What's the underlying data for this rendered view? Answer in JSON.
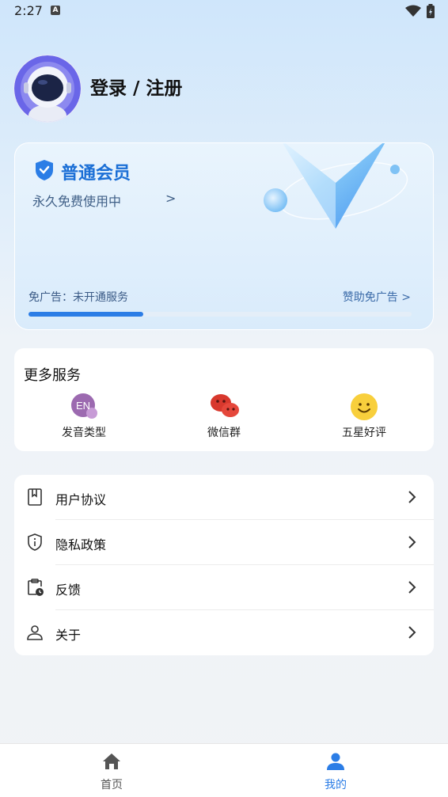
{
  "status_bar": {
    "time": "2:27",
    "a_icon": "A"
  },
  "profile": {
    "login_text": "登录 / 注册",
    "avatar": "astronaut-avatar"
  },
  "vip_card": {
    "title": "普通会员",
    "subtitle": "永久免费使用中",
    "chevron": ">",
    "ad_status": "免广告：未开通服务",
    "sponsor": "赞助免广告 >",
    "progress": 0.3
  },
  "services": {
    "title": "更多服务",
    "items": [
      {
        "label": "发音类型",
        "icon_text": "EN"
      },
      {
        "label": "微信群"
      },
      {
        "label": "五星好评"
      }
    ]
  },
  "menu": {
    "items": [
      {
        "label": "用户协议"
      },
      {
        "label": "隐私政策"
      },
      {
        "label": "反馈"
      },
      {
        "label": "关于"
      }
    ]
  },
  "tabs": [
    {
      "label": "首页",
      "active": false
    },
    {
      "label": "我的",
      "active": true
    }
  ],
  "colors": {
    "accent": "#2b7de6",
    "vip_title": "#1b6fd6",
    "tab_inactive": "#555555"
  }
}
